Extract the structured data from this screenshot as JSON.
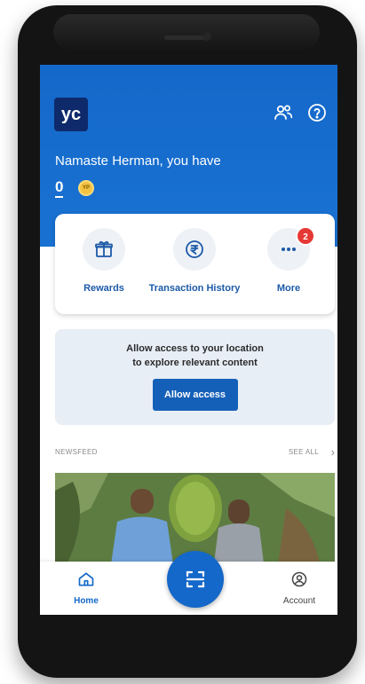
{
  "app": {
    "logo_text": "yc",
    "greeting": "Namaste Herman, you have",
    "coin_count": "0",
    "coin_symbol": "YP"
  },
  "quick_actions": [
    {
      "label": "Rewards",
      "icon": "gift-icon"
    },
    {
      "label": "Transaction History",
      "icon": "rupee-icon"
    },
    {
      "label": "More",
      "icon": "more-dots-icon",
      "badge": "2"
    }
  ],
  "location_prompt": {
    "line1": "Allow access to your location",
    "line2": "to explore relevant content",
    "button_label": "Allow access"
  },
  "newsfeed": {
    "title": "NEWSFEED",
    "see_all": "SEE ALL"
  },
  "bottom_nav": {
    "home_label": "Home",
    "account_label": "Account"
  },
  "colors": {
    "primary": "#1468c9",
    "dark_blue": "#0e2a6b",
    "accent_label": "#1c5aa8",
    "badge": "#e53935",
    "coin": "#f5c242"
  }
}
